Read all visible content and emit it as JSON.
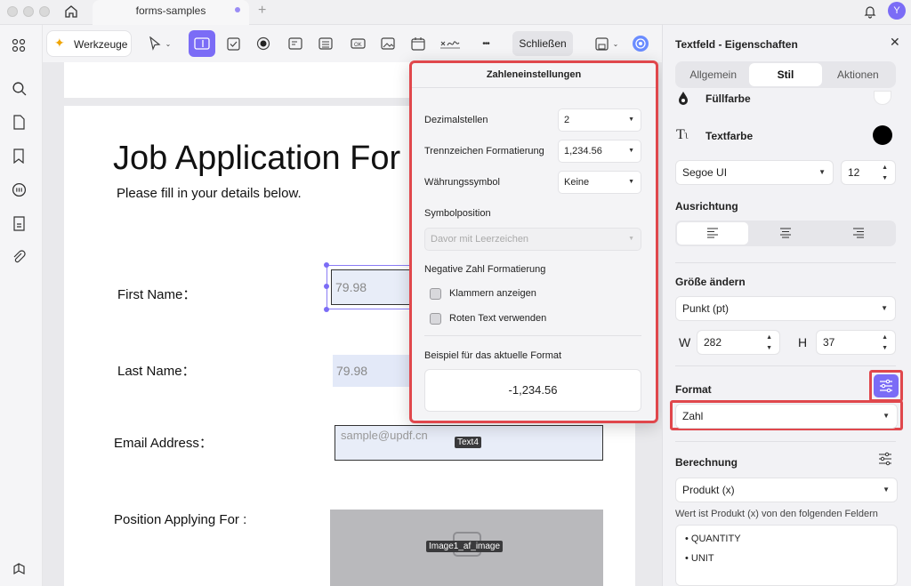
{
  "tab": {
    "title": "forms-samples",
    "add": "+"
  },
  "user": {
    "avatar": "Y"
  },
  "toolbar": {
    "tools_label": "Werkzeuge",
    "close_label": "Schließen",
    "more": "•••"
  },
  "document": {
    "title": "Job Application For",
    "subtitle": "Please fill in your details below.",
    "labels": {
      "first_name": "First Name：",
      "last_name": "Last Name：",
      "email": "Email Address：",
      "position": "Position Applying For :"
    },
    "fields": {
      "first_name_value": "79.98",
      "last_name_value": "79.98",
      "email_placeholder": "sample@updf.cn",
      "email_tag": "Text4",
      "image_tag": "Image1_af_image"
    }
  },
  "popup": {
    "title": "Zahleneinstellungen",
    "decimal_label": "Dezimalstellen",
    "decimal_value": "2",
    "separator_label": "Trennzeichen Formatierung",
    "separator_value": "1,234.56",
    "currency_label": "Währungssymbol",
    "currency_value": "Keine",
    "symbol_pos_label": "Symbolposition",
    "symbol_pos_value": "Davor mit Leerzeichen",
    "negative_label": "Negative Zahl Formatierung",
    "brackets_label": "Klammern anzeigen",
    "red_text_label": "Roten Text verwenden",
    "example_label": "Beispiel für das aktuelle Format",
    "example_value": "-1,234.56"
  },
  "panel": {
    "title": "Textfeld - Eigenschaften",
    "tabs": [
      "Allgemein",
      "Stil",
      "Aktionen"
    ],
    "fill_color_label": "Füllfarbe",
    "text_color_label": "Textfarbe",
    "font_value": "Segoe UI",
    "font_size": "12",
    "alignment_label": "Ausrichtung",
    "resize_label": "Größe ändern",
    "unit_value": "Punkt (pt)",
    "w_label": "W",
    "w_value": "282",
    "h_label": "H",
    "h_value": "37",
    "format_label": "Format",
    "format_value": "Zahl",
    "calc_label": "Berechnung",
    "calc_value": "Produkt (x)",
    "calc_desc": "Wert ist Produkt (x) von den folgenden Feldern",
    "calc_fields": [
      "QUANTITY",
      "UNIT"
    ]
  },
  "colors": {
    "accent": "#7b6cf6",
    "highlight_red": "#e0474c",
    "fill_color": "#ffffff",
    "text_color": "#000000"
  }
}
